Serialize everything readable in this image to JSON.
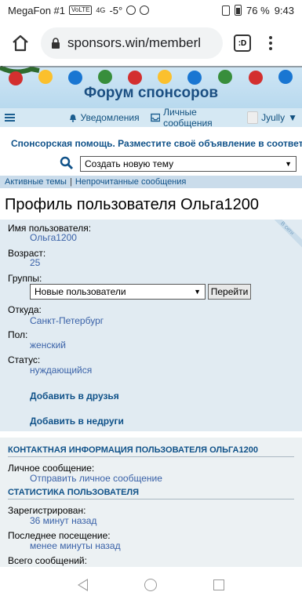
{
  "status_bar": {
    "carrier": "MegaFon #1",
    "volte": "VoLTE",
    "network": "4G",
    "temperature": "-5°",
    "battery_percent": "76 %",
    "time": "9:43"
  },
  "browser": {
    "url": "sponsors.win/memberl",
    "tabs_label": ":D"
  },
  "forum": {
    "title": "Форум спонсоров",
    "nav": {
      "notifications": "Уведомления",
      "messages": "Личные сообщения",
      "user": "Jyully"
    },
    "breadcrumb": "Спонсорская помощь. Разместите своё объявление в соответст",
    "new_topic_select": "Создать новую тему",
    "links": {
      "active": "Активные темы",
      "separator": "|",
      "unread": "Непрочитанные сообщения"
    }
  },
  "profile": {
    "page_title": "Профиль пользователя Ольга1200",
    "online_ribbon": "В сети",
    "username_label": "Имя пользователя:",
    "username": "Ольга1200",
    "age_label": "Возраст:",
    "age": "25",
    "groups_label": "Группы:",
    "groups_value": "Новые пользователи",
    "go_button": "Перейти",
    "location_label": "Откуда:",
    "location": "Санкт-Петербург",
    "gender_label": "Пол:",
    "gender": "женский",
    "status_label": "Статус:",
    "status": "нуждающийся",
    "add_friend": "Добавить в друзья",
    "add_foe": "Добавить в недруги"
  },
  "contact": {
    "heading": "КОНТАКТНАЯ ИНФОРМАЦИЯ ПОЛЬЗОВАТЕЛЯ ОЛЬГА1200",
    "pm_label": "Личное сообщение:",
    "pm_link": "Отправить личное сообщение"
  },
  "stats": {
    "heading": "СТАТИСТИКА ПОЛЬЗОВАТЕЛЯ",
    "registered_label": "Зарегистрирован:",
    "registered": "36 минут назад",
    "last_visit_label": "Последнее посещение:",
    "last_visit": "менее минуты назад",
    "total_posts_label": "Всего сообщений:"
  }
}
